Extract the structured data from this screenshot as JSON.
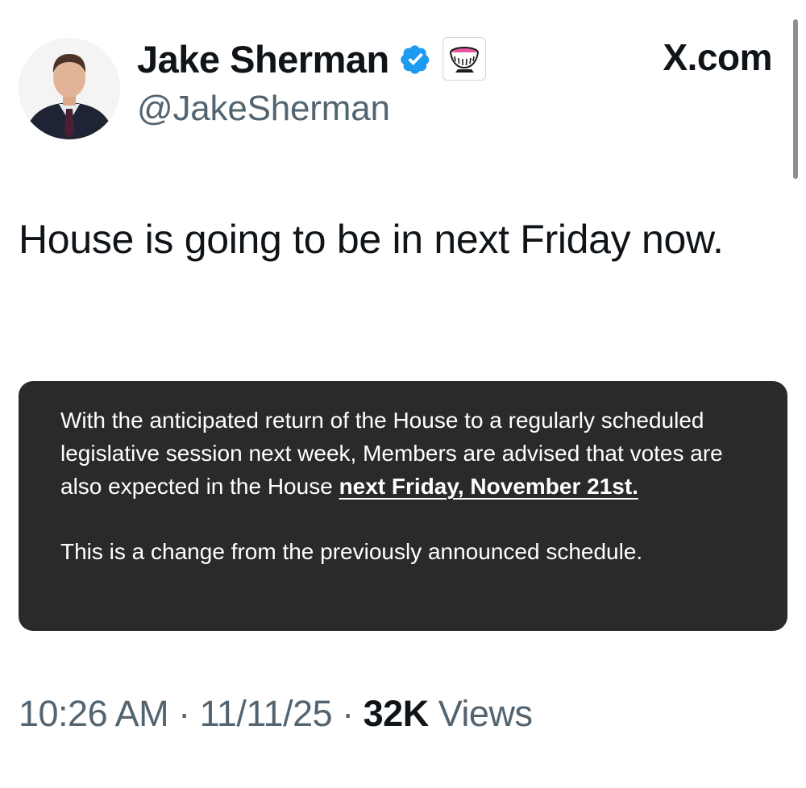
{
  "author": {
    "display_name": "Jake Sherman",
    "handle": "@JakeSherman",
    "verified_icon": "verified-badge-icon",
    "affiliation_icon": "punchbowl-icon",
    "avatar": "profile-photo"
  },
  "site": {
    "label": "X.com"
  },
  "tweet": {
    "text": "House is going to be in next Friday now."
  },
  "notice": {
    "para1_text": "With the anticipated return of the House to a regularly scheduled legislative session next week, Members are advised that votes are also expected in the House ",
    "para1_emphasis": "next Friday, November 21st.",
    "para2_text": "This is a change from the previously announced schedule."
  },
  "meta": {
    "time": "10:26 AM",
    "separator": "·",
    "date": "11/11/25",
    "views_count": "32K",
    "views_label": "Views"
  },
  "colors": {
    "verified_blue": "#1d9bf0",
    "notice_background": "#2a2a2c",
    "secondary_text": "#536471",
    "primary_text": "#0f1419"
  }
}
